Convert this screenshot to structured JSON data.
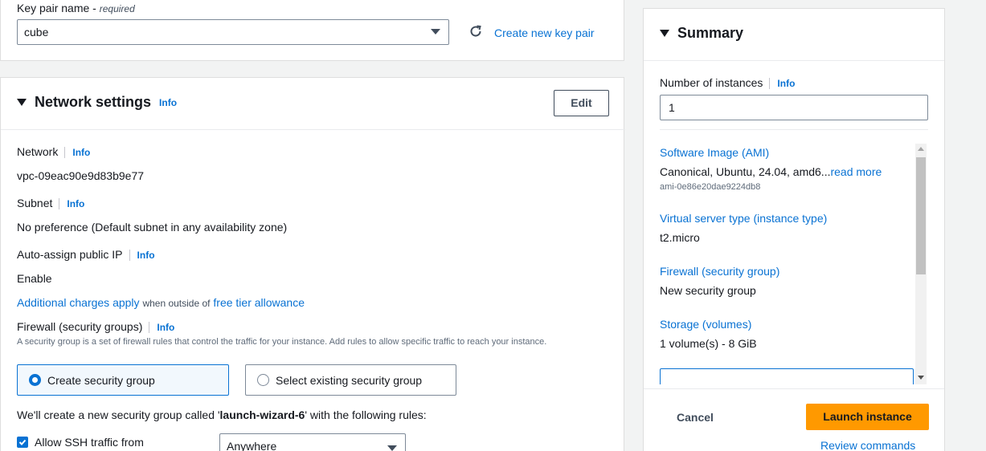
{
  "keypair": {
    "label": "Key pair name",
    "required": "required",
    "value": "cube",
    "create_link": "Create new key pair"
  },
  "network": {
    "title": "Network settings",
    "info": "Info",
    "edit_label": "Edit",
    "network_label": "Network",
    "network_value": "vpc-09eac90e9d83b9e77",
    "subnet_label": "Subnet",
    "subnet_value": "No preference (Default subnet in any availability zone)",
    "public_ip_label": "Auto-assign public IP",
    "public_ip_value": "Enable",
    "charges_link": "Additional charges apply",
    "charges_mid": "when outside of",
    "free_tier_link": "free tier allowance",
    "firewall_label": "Firewall (security groups)",
    "firewall_desc": "A security group is a set of firewall rules that control the traffic for your instance. Add rules to allow specific traffic to reach your instance.",
    "option_create": "Create security group",
    "option_existing": "Select existing security group",
    "create_note_prefix": "We'll create a new security group called '",
    "create_note_name": "launch-wizard-6",
    "create_note_suffix": "' with the following rules:",
    "ssh_label": "Allow SSH traffic from",
    "ssh_source": "Anywhere"
  },
  "summary": {
    "title": "Summary",
    "instances_label": "Number of instances",
    "info": "Info",
    "instances_value": "1",
    "ami_label": "Software Image (AMI)",
    "ami_value": "Canonical, Ubuntu, 24.04, amd6...",
    "ami_read_more": "read more",
    "ami_id": "ami-0e86e20dae9224db8",
    "type_label": "Virtual server type (instance type)",
    "type_value": "t2.micro",
    "firewall_label": "Firewall (security group)",
    "firewall_value": "New security group",
    "storage_label": "Storage (volumes)",
    "storage_value": "1 volume(s) - 8 GiB",
    "cancel_label": "Cancel",
    "launch_label": "Launch instance",
    "review_label": "Review commands"
  },
  "colors": {
    "link": "#0972d3",
    "launch": "#ff9900",
    "border": "#dedede"
  }
}
